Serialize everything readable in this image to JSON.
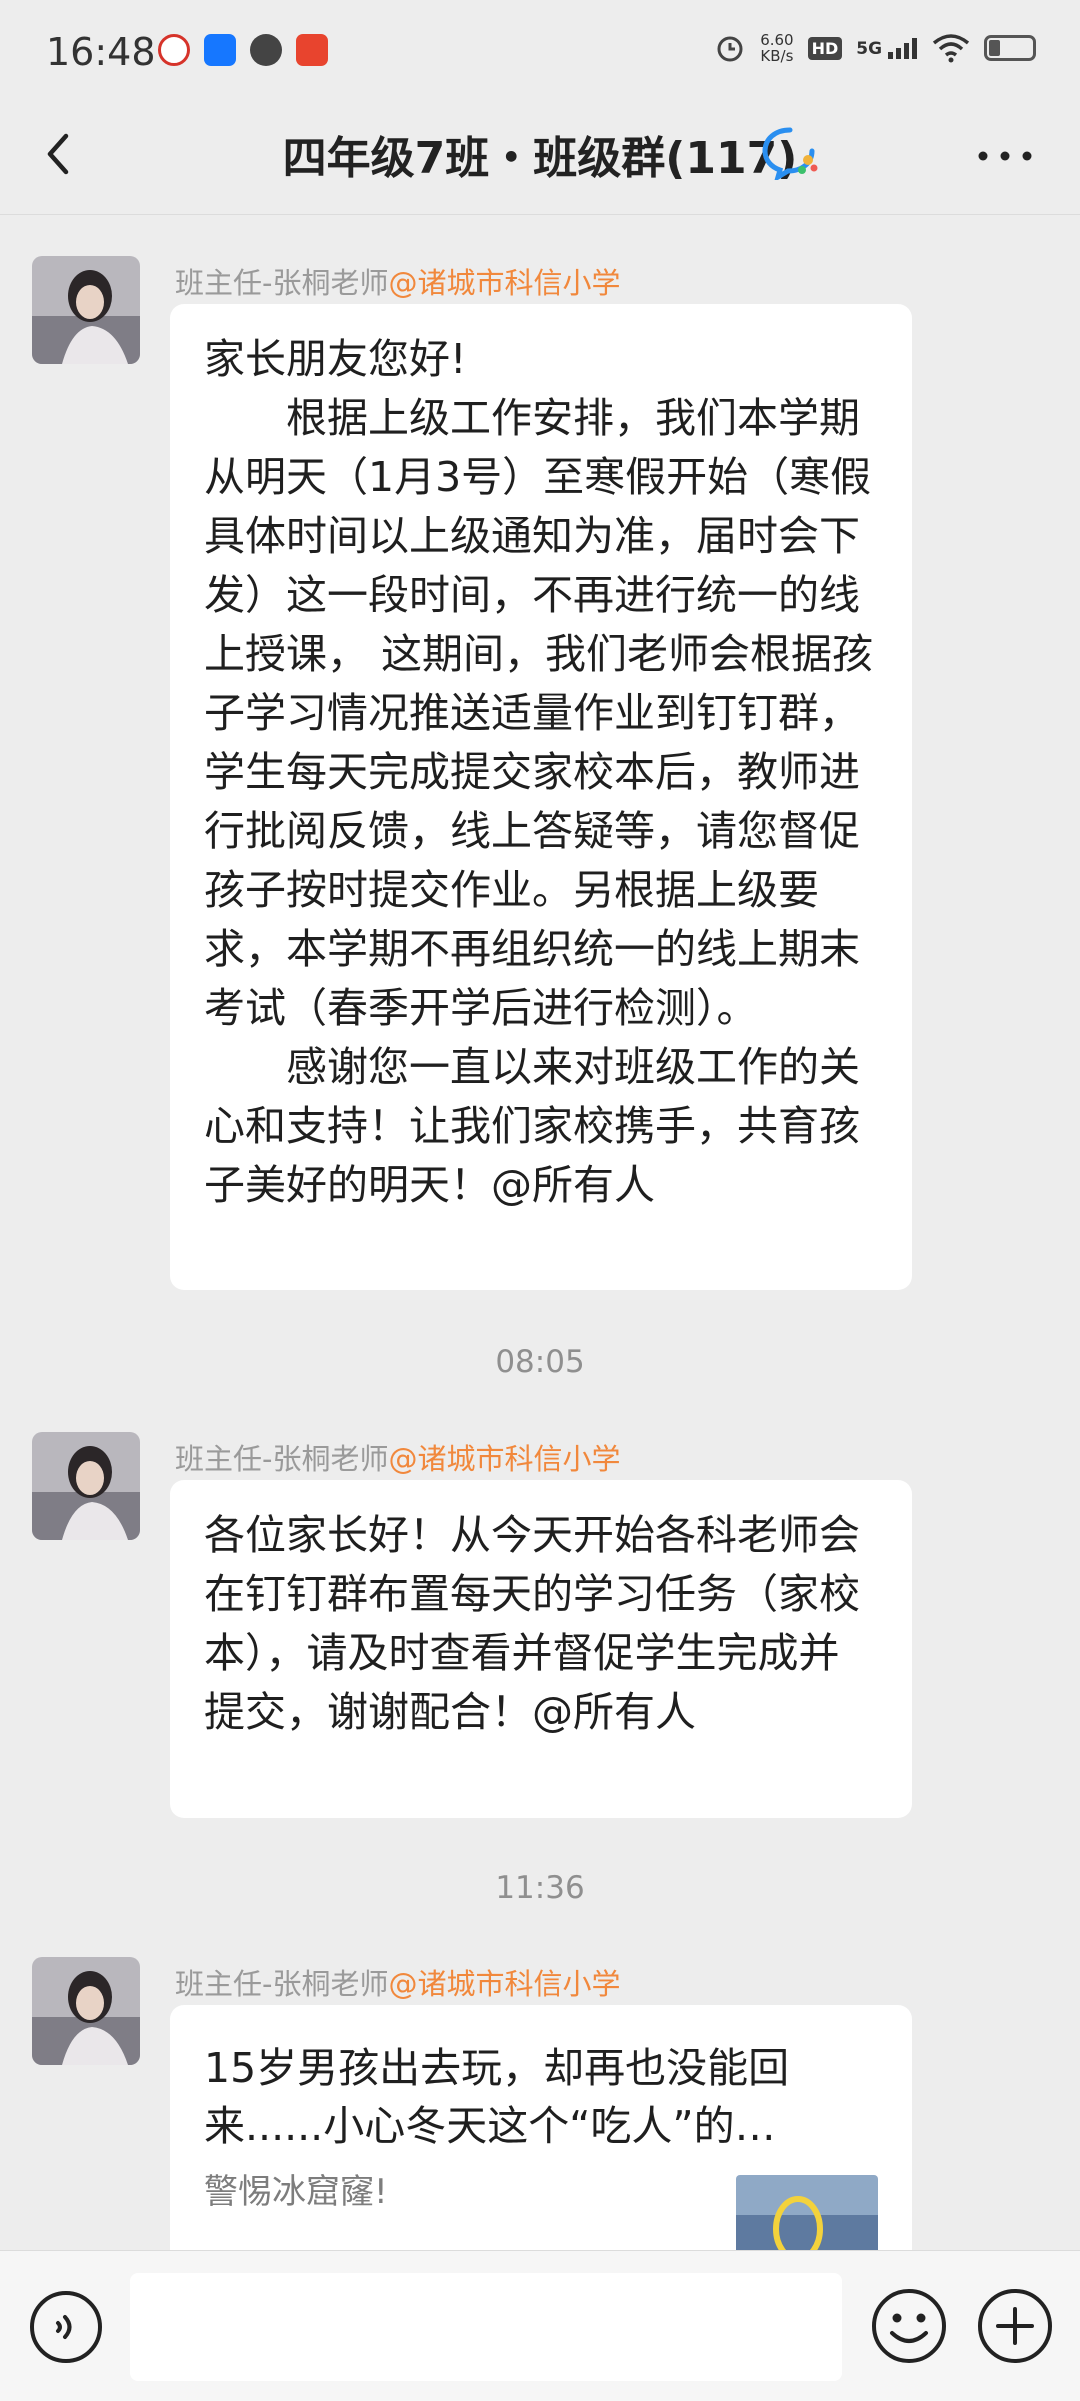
{
  "status_bar": {
    "time": "16:48",
    "net_speed_value": "6.60",
    "net_speed_unit": "KB/s",
    "hd": "HD",
    "network": "5G",
    "icons": [
      "app-icon-red",
      "app-icon-blue",
      "app-icon-dark",
      "app-icon-orange",
      "alarm-icon",
      "signal-icon",
      "wifi-icon",
      "battery-icon"
    ],
    "battery_level": 0.25
  },
  "header": {
    "title": "四年级7班・班级群(117)",
    "back_icon": "chevron-left-icon",
    "more_icon": "more-dots-icon",
    "group_icon": "chat-bubble-icon"
  },
  "messages": [
    {
      "sender_name": "班主任-张桐老师",
      "sender_org": "@诸城市科信小学",
      "paragraphs": [
        "家长朋友您好!",
        "根据上级工作安排，我们本学期从明天（1月3号）至寒假开始（寒假具体时间以上级通知为准，届时会下发）这一段时间，不再进行统一的线上授课，  这期间，我们老师会根据孩子学习情况推送适量作业到钉钉群，学生每天完成提交家校本后，教师进行批阅反馈，线上答疑等，请您督促孩子按时提交作业。另根据上级要求，本学期不再组织统一的线上期末考试（春季开学后进行检测）。",
        "感谢您一直以来对班级工作的关心和支持！让我们家校携手，共育孩子美好的明天！@所有人"
      ]
    },
    {
      "sender_name": "班主任-张桐老师",
      "sender_org": "@诸城市科信小学",
      "text": "各位家长好！从今天开始各科老师会在钉钉群布置每天的学习任务（家校本），请及时查看并督促学生完成并提交，谢谢配合！@所有人"
    },
    {
      "sender_name": "班主任-张桐老师",
      "sender_org": "@诸城市科信小学",
      "link_title": "15岁男孩出去玩，却再也没能回来......小心冬天这个“吃人”的…",
      "link_summary": "警惕冰窟窿!"
    }
  ],
  "timestamps": [
    "08:05",
    "11:36"
  ],
  "bottom_bar": {
    "voice_icon": "voice-icon",
    "emoji_icon": "emoji-icon",
    "plus_icon": "plus-icon",
    "input_placeholder": ""
  }
}
